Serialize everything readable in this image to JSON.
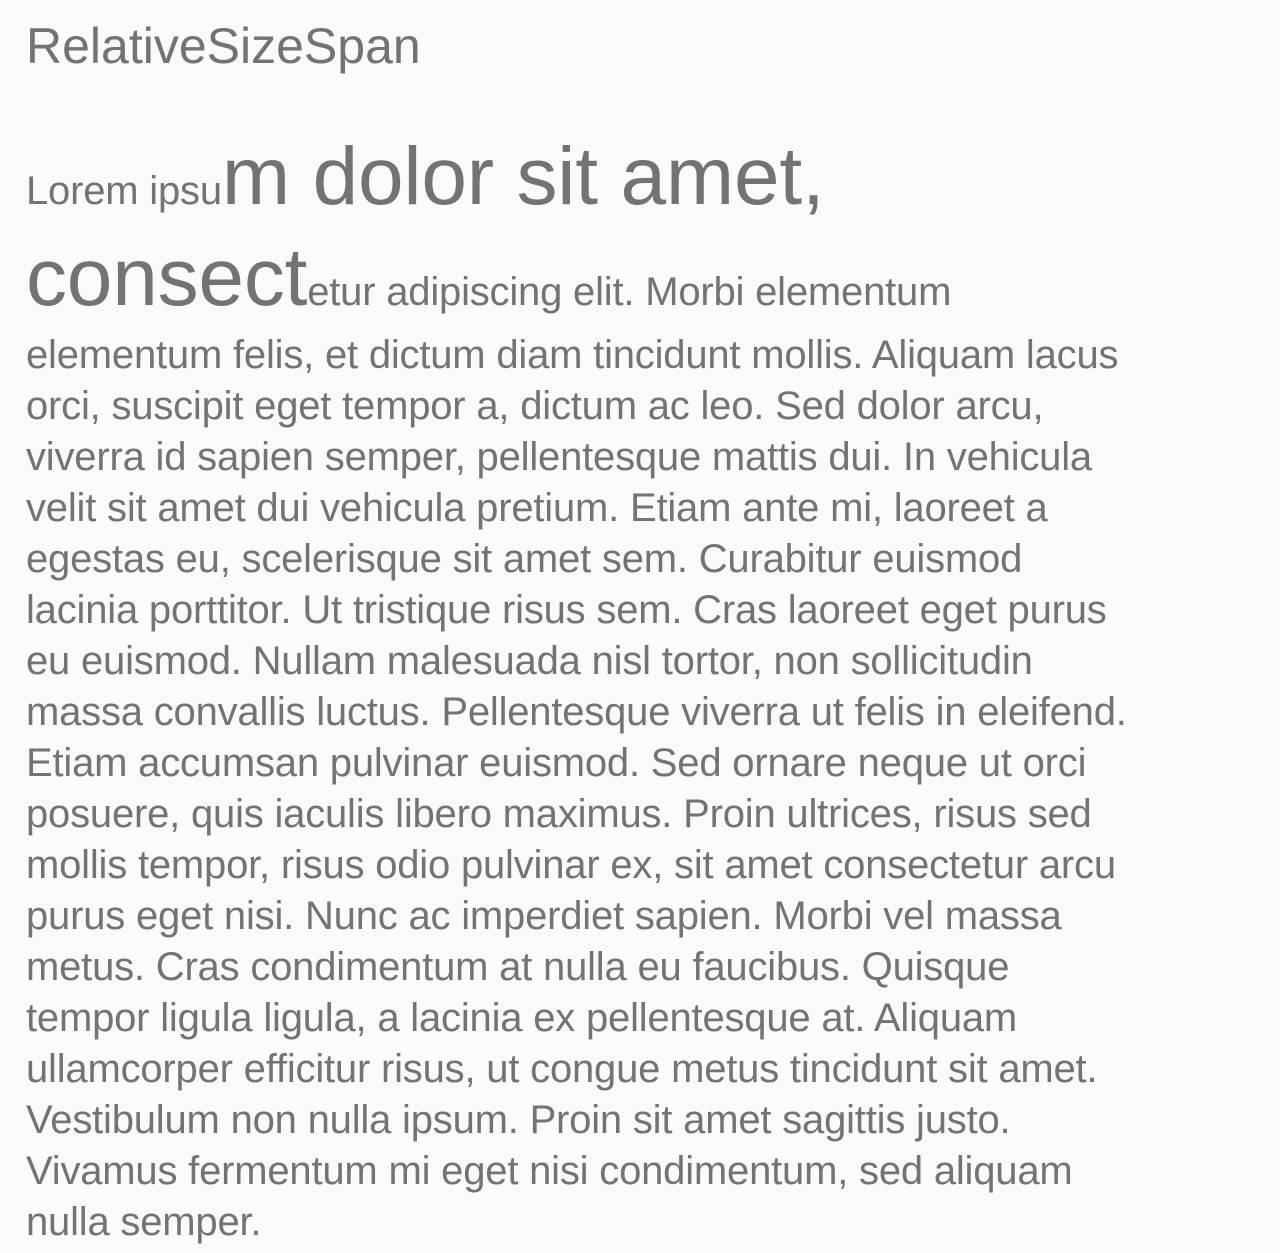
{
  "title": "RelativeSizeSpan",
  "paragraph": {
    "line1": {
      "normal": "Lorem ipsu",
      "large": "m dolor sit amet,"
    },
    "line2": {
      "large": "consect",
      "normal": "etur adipiscing elit. Morbi elementum"
    },
    "body_lines": [
      "elementum felis, et dictum diam tincidunt mollis. Aliquam lacus",
      "orci, suscipit eget tempor a, dictum ac leo. Sed dolor arcu,",
      "viverra id sapien semper, pellentesque mattis dui. In vehicula",
      "velit sit amet dui vehicula pretium. Etiam ante mi, laoreet a",
      "egestas eu, scelerisque sit amet sem. Curabitur euismod",
      "lacinia porttitor. Ut tristique risus sem. Cras laoreet eget purus",
      "eu euismod. Nullam malesuada nisl tortor, non sollicitudin",
      "massa convallis luctus. Pellentesque viverra ut felis in eleifend.",
      "Etiam accumsan pulvinar euismod. Sed ornare neque ut orci",
      "posuere, quis iaculis libero maximus. Proin ultrices, risus sed",
      "mollis tempor, risus odio pulvinar ex, sit amet consectetur arcu",
      "purus eget nisi. Nunc ac imperdiet sapien. Morbi vel massa",
      "metus. Cras condimentum at nulla eu faucibus. Quisque",
      "tempor ligula ligula, a lacinia ex pellentesque at. Aliquam",
      "ullamcorper efficitur risus, ut congue metus tincidunt sit amet.",
      "Vestibulum non nulla ipsum. Proin sit amet sagittis justo.",
      "Vivamus fermentum mi eget nisi condimentum, sed aliquam",
      "nulla semper."
    ]
  },
  "colors": {
    "background": "#fafafa",
    "text": "#737373"
  }
}
